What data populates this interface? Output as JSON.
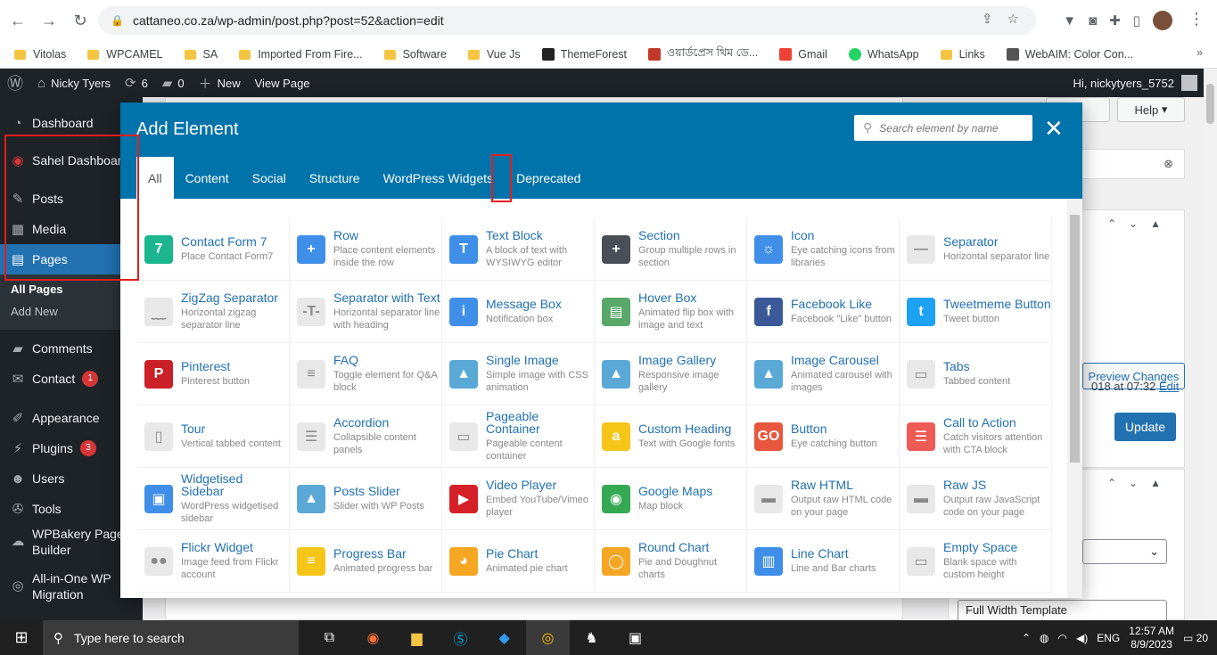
{
  "browser": {
    "url": "cattaneo.co.za/wp-admin/post.php?post=52&action=edit",
    "bookmarks": [
      {
        "label": "Vitolas",
        "type": "folder"
      },
      {
        "label": "WPCAMEL",
        "type": "folder"
      },
      {
        "label": "SA",
        "type": "folder"
      },
      {
        "label": "Imported From Fire...",
        "type": "folder"
      },
      {
        "label": "Software",
        "type": "folder"
      },
      {
        "label": "Vue Js",
        "type": "folder"
      },
      {
        "label": "ThemeForest",
        "type": "site",
        "color": "#222222"
      },
      {
        "label": "ওয়ার্ডপ্রেস থিম ডে...",
        "type": "site",
        "color": "#c0392b"
      },
      {
        "label": "Gmail",
        "type": "site",
        "color": "#ea4335"
      },
      {
        "label": "WhatsApp",
        "type": "site",
        "color": "#25d366"
      },
      {
        "label": "Links",
        "type": "folder"
      },
      {
        "label": "WebAIM: Color Con...",
        "type": "site",
        "color": "#555555"
      }
    ],
    "more_symbol": "»"
  },
  "adminbar": {
    "site_name": "Nicky Tyers",
    "updates_count": "6",
    "comments_count": "0",
    "new_label": "New",
    "view_page_label": "View Page",
    "greeting": "Hi, nickytyers_5752"
  },
  "sidebar": {
    "dashboard": "Dashboard",
    "sahel": "Sahel Dashboard",
    "posts": "Posts",
    "media": "Media",
    "pages": "Pages",
    "all_pages": "All Pages",
    "add_new": "Add New",
    "comments": "Comments",
    "contact": "Contact",
    "contact_badge": "1",
    "appearance": "Appearance",
    "plugins": "Plugins",
    "plugins_badge": "3",
    "users": "Users",
    "tools": "Tools",
    "wpbakery": "WPBakery Page Builder",
    "aio": "All-in-One WP Migration"
  },
  "right_panel": {
    "help_label": "Help",
    "preview_label": "Preview Changes",
    "date_text": "018 at 07:32",
    "edit_link": "Edit",
    "update_label": "Update",
    "template_value": "Full Width Template"
  },
  "modal": {
    "title": "Add Element",
    "search_placeholder": "Search element by name",
    "close_symbol": "✕",
    "tabs": [
      "All",
      "Content",
      "Social",
      "Structure",
      "WordPress Widgets",
      "Deprecated"
    ],
    "elements": [
      {
        "name": "Contact Form 7",
        "desc": "Place Contact Form7",
        "icon": "7",
        "color": "#1bb58e"
      },
      {
        "name": "Row",
        "desc": "Place content elements inside the row",
        "icon": "+",
        "color": "#3f8ee8"
      },
      {
        "name": "Text Block",
        "desc": "A block of text with WYSIWYG editor",
        "icon": "T",
        "color": "#3f8ee8"
      },
      {
        "name": "Section",
        "desc": "Group multiple rows in section",
        "icon": "+",
        "color": "#4a4f57"
      },
      {
        "name": "Icon",
        "desc": "Eye catching icons from libraries",
        "icon": "☼",
        "color": "#3f8ee8"
      },
      {
        "name": "Separator",
        "desc": "Horizontal separator line",
        "icon": "—",
        "color": "#e8e8e8"
      },
      {
        "name": "ZigZag Separator",
        "desc": "Horizontal zigzag separator line",
        "icon": "﹏",
        "color": "#e8e8e8"
      },
      {
        "name": "Separator with Text",
        "desc": "Horizontal separator line with heading",
        "icon": "-T-",
        "color": "#e8e8e8"
      },
      {
        "name": "Message Box",
        "desc": "Notification box",
        "icon": "i",
        "color": "#3f8ee8"
      },
      {
        "name": "Hover Box",
        "desc": "Animated flip box with image and text",
        "icon": "▤",
        "color": "#59a86a"
      },
      {
        "name": "Facebook Like",
        "desc": "Facebook \"Like\" button",
        "icon": "f",
        "color": "#3b5998"
      },
      {
        "name": "Tweetmeme Button",
        "desc": "Tweet button",
        "icon": "t",
        "color": "#1da1f2"
      },
      {
        "name": "Pinterest",
        "desc": "Pinterest button",
        "icon": "P",
        "color": "#cb2027"
      },
      {
        "name": "FAQ",
        "desc": "Toggle element for Q&A block",
        "icon": "≡",
        "color": "#e8e8e8"
      },
      {
        "name": "Single Image",
        "desc": "Simple image with CSS animation",
        "icon": "▲",
        "color": "#59a8d6"
      },
      {
        "name": "Image Gallery",
        "desc": "Responsive image gallery",
        "icon": "▲",
        "color": "#59a8d6"
      },
      {
        "name": "Image Carousel",
        "desc": "Animated carousel with images",
        "icon": "▲",
        "color": "#59a8d6"
      },
      {
        "name": "Tabs",
        "desc": "Tabbed content",
        "icon": "▭",
        "color": "#e8e8e8"
      },
      {
        "name": "Tour",
        "desc": "Vertical tabbed content",
        "icon": "▯",
        "color": "#e8e8e8"
      },
      {
        "name": "Accordion",
        "desc": "Collapsible content panels",
        "icon": "☰",
        "color": "#e8e8e8"
      },
      {
        "name": "Pageable Container",
        "desc": "Pageable content container",
        "icon": "▭",
        "color": "#e8e8e8"
      },
      {
        "name": "Custom Heading",
        "desc": "Text with Google fonts",
        "icon": "a",
        "color": "#f5c518"
      },
      {
        "name": "Button",
        "desc": "Eye catching button",
        "icon": "GO",
        "color": "#e7573d"
      },
      {
        "name": "Call to Action",
        "desc": "Catch visitors attention with CTA block",
        "icon": "☰",
        "color": "#ee5a55"
      },
      {
        "name": "Widgetised Sidebar",
        "desc": "WordPress widgetised sidebar",
        "icon": "▣",
        "color": "#3f8ee8"
      },
      {
        "name": "Posts Slider",
        "desc": "Slider with WP Posts",
        "icon": "▲",
        "color": "#59a8d6"
      },
      {
        "name": "Video Player",
        "desc": "Embed YouTube/Vimeo player",
        "icon": "▶",
        "color": "#d62027"
      },
      {
        "name": "Google Maps",
        "desc": "Map block",
        "icon": "◉",
        "color": "#34a853"
      },
      {
        "name": "Raw HTML",
        "desc": "Output raw HTML code on your page",
        "icon": "▬",
        "color": "#e8e8e8"
      },
      {
        "name": "Raw JS",
        "desc": "Output raw JavaScript code on your page",
        "icon": "▬",
        "color": "#e8e8e8"
      },
      {
        "name": "Flickr Widget",
        "desc": "Image feed from Flickr account",
        "icon": "●●",
        "color": "#e8e8e8"
      },
      {
        "name": "Progress Bar",
        "desc": "Animated progress bar",
        "icon": "≡",
        "color": "#f5c518"
      },
      {
        "name": "Pie Chart",
        "desc": "Animated pie chart",
        "icon": "◕",
        "color": "#f5a623"
      },
      {
        "name": "Round Chart",
        "desc": "Pie and Doughnut charts",
        "icon": "◯",
        "color": "#f5a623"
      },
      {
        "name": "Line Chart",
        "desc": "Line and Bar charts",
        "icon": "▥",
        "color": "#3f8ee8"
      },
      {
        "name": "Empty Space",
        "desc": "Blank space with custom height",
        "icon": "▭",
        "color": "#e8e8e8"
      }
    ]
  },
  "taskbar": {
    "search_placeholder": "Type here to search",
    "lang": "ENG",
    "time": "12:57 AM",
    "date": "8/9/2023",
    "notif_count": "20"
  }
}
